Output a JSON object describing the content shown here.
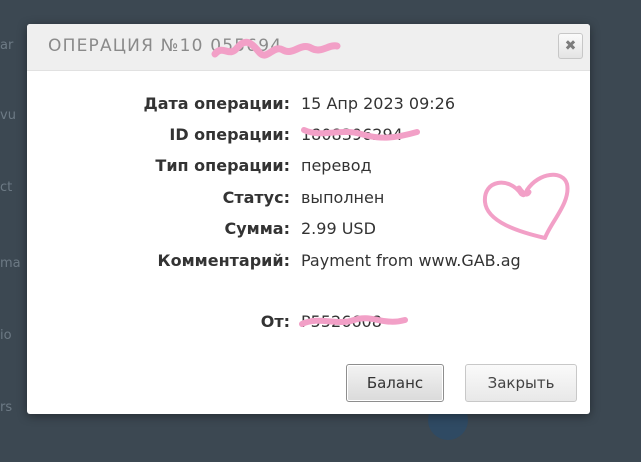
{
  "background": {
    "fragments": [
      "ar",
      "vu",
      "ct",
      "ma",
      "io",
      "rs"
    ]
  },
  "modal": {
    "title": "ОПЕРАЦИЯ №10 055694",
    "close_symbol": "✖",
    "fields": [
      {
        "label": "Дата операции:",
        "value": "15 Апр 2023 09:26"
      },
      {
        "label": "ID операции:",
        "value": "1808396294"
      },
      {
        "label": "Тип операции:",
        "value": "перевод"
      },
      {
        "label": "Статус:",
        "value": "выполнен"
      },
      {
        "label": "Сумма:",
        "value": "2.99 USD"
      },
      {
        "label": "Комментарий:",
        "value": "Payment from www.GAB.ag"
      },
      {
        "label": "От:",
        "value": "P5526608"
      }
    ],
    "buttons": {
      "balance": "Баланс",
      "close": "Закрыть"
    }
  },
  "colors": {
    "scribble": "#f2a0c7",
    "overlay": "#3c4852"
  }
}
